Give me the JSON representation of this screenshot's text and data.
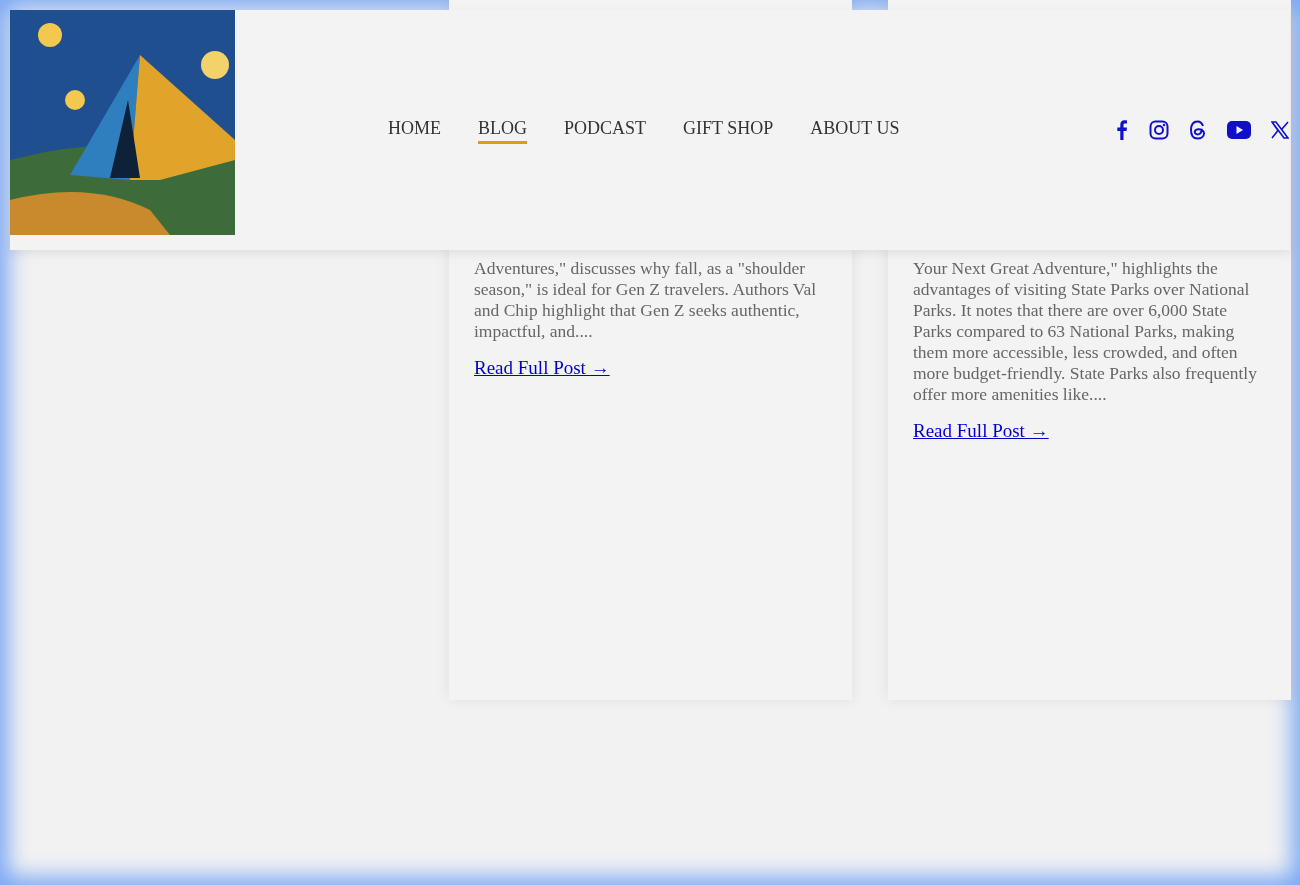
{
  "header": {
    "nav": [
      {
        "label": "HOME",
        "selected": false
      },
      {
        "label": "BLOG",
        "selected": true
      },
      {
        "label": "PODCAST",
        "selected": false
      },
      {
        "label": "GIFT SHOP",
        "selected": false
      },
      {
        "label": "ABOUT US",
        "selected": false
      }
    ],
    "social": [
      {
        "kind": "facebook"
      },
      {
        "kind": "instagram"
      },
      {
        "kind": "threads"
      },
      {
        "kind": "youtube"
      },
      {
        "kind": "x"
      }
    ]
  },
  "posts": [
    {
      "excerpt": "Adventures,\" discusses why fall, as a \"shoulder season,\" is ideal for Gen Z travelers. Authors Val and Chip highlight that Gen Z seeks authentic, impactful, and....",
      "link": "Read Full Post →"
    },
    {
      "excerpt": "Your Next Great Adventure,\" highlights the advantages of visiting State Parks over National Parks. It notes that there are over 6,000 State Parks compared to 63 National Parks, making them more accessible, less crowded, and often more budget-friendly. State Parks also frequently offer more amenities like....",
      "link": "Read Full Post →"
    }
  ]
}
